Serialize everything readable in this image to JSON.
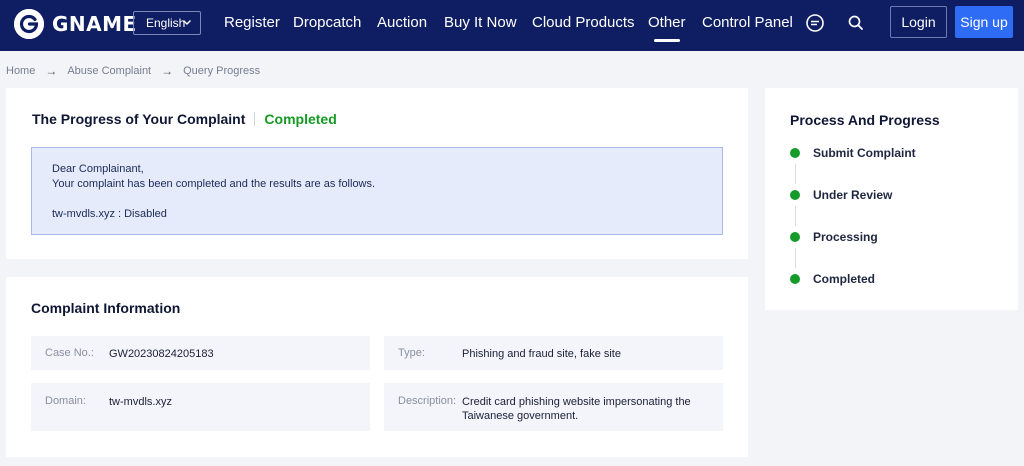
{
  "header": {
    "brand": "GNAME",
    "language": "English",
    "nav": [
      "Register",
      "Dropcatch",
      "Auction",
      "Buy It Now",
      "Cloud Products",
      "Other",
      "Control Panel"
    ],
    "active_nav": "Other",
    "login": "Login",
    "signup": "Sign up",
    "colors": {
      "bar": "#0f1e62",
      "signup": "#2f6cf6"
    }
  },
  "breadcrumb": [
    "Home",
    "Abuse Complaint",
    "Query Progress"
  ],
  "progress": {
    "title": "The Progress of Your Complaint",
    "status": "Completed",
    "message": {
      "greeting": "Dear Complainant,",
      "line": "Your complaint has been completed and the results are as follows.",
      "result": "tw-mvdls.xyz : Disabled"
    }
  },
  "info": {
    "title": "Complaint Information",
    "case_label": "Case No.:",
    "case_value": "GW20230824205183",
    "type_label": "Type:",
    "type_value": "Phishing and fraud site, fake site",
    "domain_label": "Domain:",
    "domain_value": "tw-mvdls.xyz",
    "desc_label": "Description:",
    "desc_value": "Credit card phishing website impersonating the Taiwanese government."
  },
  "side": {
    "title": "Process And Progress",
    "steps": [
      "Submit Complaint",
      "Under Review",
      "Processing",
      "Completed"
    ],
    "step_color": "#169b2a"
  }
}
